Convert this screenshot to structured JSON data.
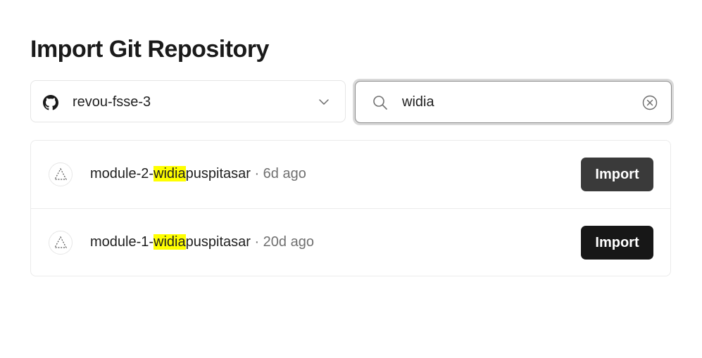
{
  "page": {
    "title": "Import Git Repository"
  },
  "scope_select": {
    "value": "revou-fsse-3",
    "icon": "github-icon"
  },
  "search": {
    "value": "widia",
    "placeholder": "Search..."
  },
  "repos": [
    {
      "prefix": "module-2-",
      "match": "widia",
      "suffix": "puspitasar",
      "meta": " · 6d ago",
      "button_label": "Import"
    },
    {
      "prefix": "module-1-",
      "match": "widia",
      "suffix": "puspitasar",
      "meta": " · 20d ago",
      "button_label": "Import"
    }
  ],
  "colors": {
    "highlight": "#ffff00",
    "button_hover": "#3a3a3a",
    "button": "#171717"
  }
}
